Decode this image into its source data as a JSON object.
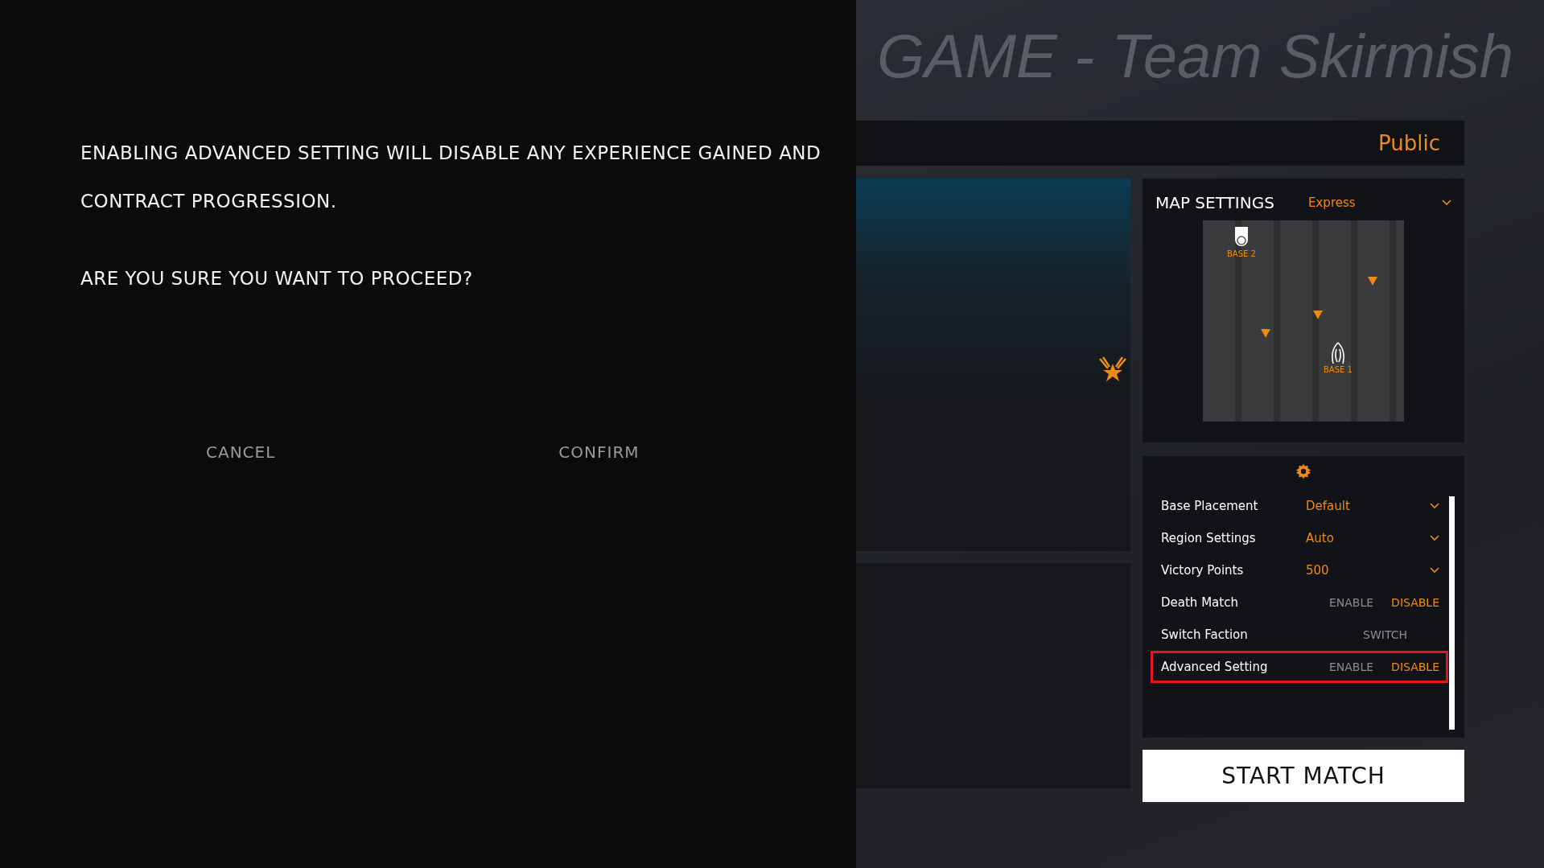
{
  "dialog": {
    "message": [
      "ENABLING ADVANCED SETTING WILL DISABLE ANY EXPERIENCE GAINED AND CONTRACT PROGRESSION.",
      "ARE YOU SURE YOU WANT TO PROCEED?"
    ],
    "buttons": [
      "CANCEL",
      "CONFIRM"
    ]
  },
  "title": "GAME - Team Skirmish",
  "visibility": "Public",
  "map_settings": {
    "title": "MAP SETTINGS",
    "value": "Express",
    "map": {
      "bases": [
        {
          "label": "BASE 2",
          "kind": "shield"
        },
        {
          "label": "BASE 1",
          "kind": "claw"
        }
      ]
    }
  },
  "settings": [
    {
      "label": "Base Placement",
      "kind": "dropdown",
      "value": "Default",
      "highlighted": false
    },
    {
      "label": "Region Settings",
      "kind": "dropdown",
      "value": "Auto",
      "highlighted": false
    },
    {
      "label": "Victory Points",
      "kind": "dropdown",
      "value": "500",
      "highlighted": false
    },
    {
      "label": "Death Match",
      "kind": "toggle",
      "options": [
        {
          "label": "ENABLE",
          "selected": false
        },
        {
          "label": "DISABLE",
          "selected": true
        }
      ],
      "highlighted": false
    },
    {
      "label": "Switch Faction",
      "kind": "action",
      "action": "SWITCH",
      "highlighted": false
    },
    {
      "label": "Advanced Setting",
      "kind": "toggle",
      "options": [
        {
          "label": "ENABLE",
          "selected": false
        },
        {
          "label": "DISABLE",
          "selected": true
        }
      ],
      "highlighted": true
    }
  ],
  "start_button": "START MATCH"
}
